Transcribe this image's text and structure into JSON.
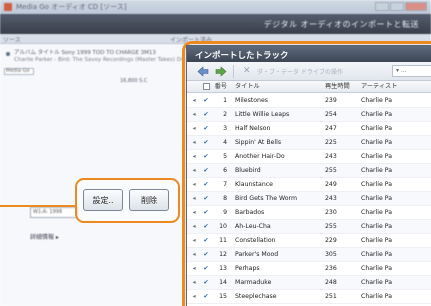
{
  "background_window": {
    "title": "Media Go  オーディオ CD [ソース]",
    "header_text": "デジタル オーディオのインポートと転送",
    "tab_left": "ソース",
    "tab_right": "インポート済み",
    "source_item_line1": "アルバム タイトル Sony 1999  TOD TO CHARGE 3M13",
    "source_item_line2": "Charlie Parker - Bird: The Savoy Recordings (Master Takes) Dis",
    "small_field": "Media Go",
    "size_label": "16,800 S.C",
    "bottom_field": "W1:A: 1998",
    "bottom_link": "詳細情報 ▸"
  },
  "buttons": {
    "settings_label": "設定..",
    "delete_label": "削除"
  },
  "tracks_window": {
    "title": "インポートしたトラック",
    "toolbar_search": "ダ・ブ・データ ドライブの操作",
    "toolbar_dropdown": "▾ ...",
    "columns": [
      "",
      "",
      "番号",
      "タイトル",
      "再生時間",
      "アーティスト"
    ],
    "rows": [
      {
        "num": "1",
        "title": "Milestones",
        "dur": "239",
        "artist": "Charlie Pa"
      },
      {
        "num": "2",
        "title": "Little Willie Leaps",
        "dur": "254",
        "artist": "Charlie Pa"
      },
      {
        "num": "3",
        "title": "Half Nelson",
        "dur": "247",
        "artist": "Charlie Pa"
      },
      {
        "num": "4",
        "title": "Sippin' At Bells",
        "dur": "225",
        "artist": "Charlie Pa"
      },
      {
        "num": "5",
        "title": "Another Hair-Do",
        "dur": "243",
        "artist": "Charlie Pa"
      },
      {
        "num": "6",
        "title": "Bluebird",
        "dur": "255",
        "artist": "Charlie Pa"
      },
      {
        "num": "7",
        "title": "Klaunstance",
        "dur": "249",
        "artist": "Charlie Pa"
      },
      {
        "num": "8",
        "title": "Bird Gets The Worm",
        "dur": "243",
        "artist": "Charlie Pa"
      },
      {
        "num": "9",
        "title": "Barbados",
        "dur": "230",
        "artist": "Charlie Pa"
      },
      {
        "num": "10",
        "title": "Ah-Leu-Cha",
        "dur": "255",
        "artist": "Charlie Pa"
      },
      {
        "num": "11",
        "title": "Constellation",
        "dur": "229",
        "artist": "Charlie Pa"
      },
      {
        "num": "12",
        "title": "Parker's Mood",
        "dur": "305",
        "artist": "Charlie Pa"
      },
      {
        "num": "13",
        "title": "Perhaps",
        "dur": "236",
        "artist": "Charlie Pa"
      },
      {
        "num": "14",
        "title": "Marmaduke",
        "dur": "248",
        "artist": "Charlie Pa"
      },
      {
        "num": "15",
        "title": "Steeplechase",
        "dur": "251",
        "artist": "Charlie Pa"
      }
    ]
  },
  "colors": {
    "highlight": "#ec8a1f",
    "titlebar": "#3b4554"
  }
}
